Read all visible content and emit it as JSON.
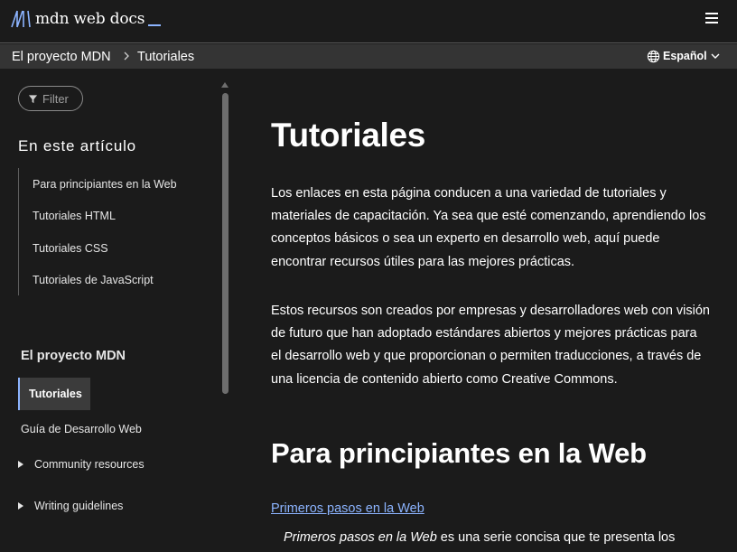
{
  "header": {
    "logo_text": "mdn web docs",
    "menu_icon": "hamburger-icon"
  },
  "breadcrumb": {
    "items": [
      "El proyecto MDN",
      "Tutoriales"
    ],
    "language": "Español"
  },
  "sidebar": {
    "filter_placeholder": "Filter",
    "toc_heading": "En este artículo",
    "toc_items": [
      "Para principiantes en la Web",
      "Tutoriales HTML",
      "Tutoriales CSS",
      "Tutoriales de JavaScript"
    ],
    "section_title": "El proyecto MDN",
    "active_item": "Tutoriales",
    "link_item": "Guía de Desarrollo Web",
    "expandable_items": [
      "Community resources",
      "Writing guidelines"
    ]
  },
  "main": {
    "title": "Tutoriales",
    "paragraph1": "Los enlaces en esta página conducen a una variedad de tutoriales y materiales de capacitación. Ya sea que esté comenzando, aprendiendo los conceptos básicos o sea un experto en desarrollo web, aquí puede encontrar recursos útiles para las mejores prácticas.",
    "paragraph2": "Estos recursos son creados por empresas y desarrolladores web con visión de futuro que han adoptado estándares abiertos y mejores prácticas para el desarrollo web y que proporcionan o permiten traducciones, a través de una licencia de contenido abierto como Creative Commons.",
    "section_heading": "Para principiantes en la Web",
    "section_link": "Primeros pasos en la Web",
    "section_text_italic": "Primeros pasos en la Web",
    "section_text_rest": " es una serie concisa que te presenta los"
  },
  "colors": {
    "background": "#1b1b1b",
    "breadcrumb_bar": "#343434",
    "link": "#8cb4ff"
  }
}
